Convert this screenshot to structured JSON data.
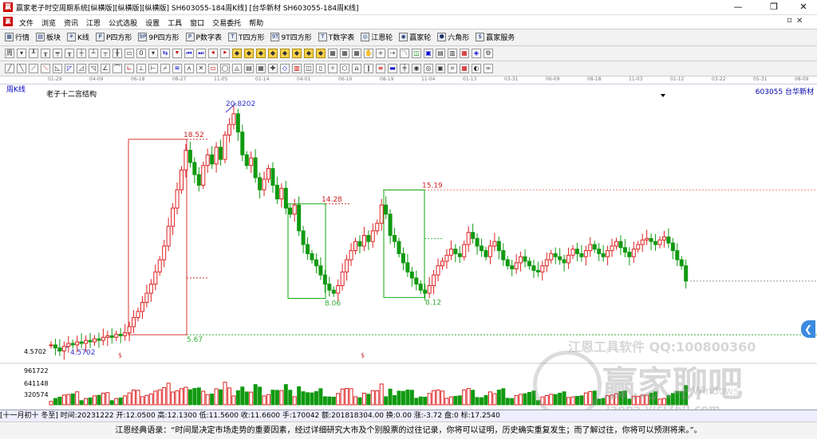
{
  "window": {
    "title": "赢家老子时空周期系统[纵横版][纵横版][纵横版]  SH603055-184周K线]  [台华新材  SH603055-184周K线]",
    "title_short": "赢家老子时空周期系统[纵横版][纵横版][纵横版]  SH603055-184周K线] [台华新材  SH603055-184周K线]"
  },
  "menu": [
    "文件",
    "浏览",
    "资讯",
    "江恩",
    "公式选股",
    "设置",
    "工具",
    "窗口",
    "交易委托",
    "帮助"
  ],
  "toolbar1": [
    "行情",
    "板块",
    "K线",
    "P四方形",
    "9P四方形",
    "P数字表",
    "T四方形",
    "9T四方形",
    "T数字表",
    "江恩轮",
    "赢家轮",
    "六角形",
    "赢家服务"
  ],
  "toolbar2_first": "周",
  "toolbar2_zero": "0",
  "chart": {
    "period_label": "周K线",
    "structure_label": "老子十二宫结构",
    "code_label": "603055  台华新材",
    "date_ticks": [
      "01-29",
      "04-09",
      "06-18",
      "08-27",
      "11-05",
      "01-14",
      "04-01",
      "06-10",
      "08-19",
      "11-04",
      "01-13",
      "03-31",
      "06-09",
      "08-18",
      "11-03",
      "01-12",
      "03-22",
      "05-31",
      "08-09"
    ],
    "price_annotations": [
      "20.8202",
      "18.52",
      "14.28",
      "15.19",
      "8.06",
      "8.12",
      "5.67",
      "4.5702"
    ],
    "left_axis": [
      "4.5702",
      "961722",
      "641148",
      "320574"
    ],
    "dollar_marks": [
      "$",
      "$"
    ]
  },
  "chart_data": {
    "type": "candlestick",
    "price_range": [
      4.0,
      21.5
    ],
    "key_levels": {
      "high": 20.8202,
      "box1_top": 18.52,
      "box2_top": 14.28,
      "box3_top": 15.19,
      "box2_low": 8.06,
      "box3_low": 8.12,
      "box1_low": 5.67,
      "start_low": 4.5702
    },
    "close_series": [
      5.0,
      4.8,
      4.6,
      4.9,
      5.1,
      5.0,
      5.2,
      5.1,
      5.3,
      5.2,
      5.4,
      5.3,
      5.5,
      5.6,
      5.5,
      5.7,
      5.6,
      5.8,
      6.2,
      6.8,
      7.2,
      7.8,
      8.4,
      9.0,
      9.8,
      10.6,
      11.5,
      12.8,
      14.0,
      15.2,
      16.5,
      17.8,
      17.0,
      16.2,
      15.5,
      16.8,
      17.5,
      16.9,
      18.0,
      17.2,
      18.8,
      19.5,
      20.2,
      19.0,
      17.5,
      16.8,
      17.3,
      16.0,
      15.2,
      15.9,
      16.6,
      15.5,
      14.6,
      15.3,
      14.0,
      13.6,
      14.2,
      12.5,
      11.6,
      11.0,
      10.6,
      10.2,
      9.6,
      9.0,
      8.6,
      8.4,
      8.9,
      9.8,
      10.6,
      11.2,
      11.8,
      11.5,
      12.2,
      11.8,
      12.5,
      13.0,
      14.2,
      13.6,
      12.2,
      11.8,
      11.0,
      10.4,
      9.8,
      9.4,
      9.0,
      8.6,
      8.4,
      8.9,
      9.6,
      10.2,
      10.5,
      10.9,
      11.3,
      11.0,
      10.8,
      11.6,
      12.4,
      12.0,
      11.5,
      11.2,
      10.8,
      11.5,
      11.8,
      11.2,
      10.6,
      10.2,
      10.0,
      10.4,
      10.8,
      10.5,
      10.2,
      9.9,
      9.8,
      10.2,
      10.6,
      11.0,
      10.8,
      10.6,
      10.4,
      10.9,
      11.3,
      11.0,
      10.8,
      11.2,
      11.6,
      11.3,
      11.0,
      10.8,
      11.2,
      11.5,
      11.8,
      11.4,
      11.1,
      10.8,
      11.3,
      11.6,
      11.9,
      12.0,
      11.8,
      11.6,
      11.9,
      12.1,
      11.7,
      11.2,
      10.6,
      10.2,
      9.2
    ],
    "volume_range": [
      0,
      1282296
    ]
  },
  "status": {
    "text": "[十一月初十 冬至] 时间:20231222 开:12.0500 高:12.1300 低:11.5600 收:11.6600 手:170042 额:201818304.00 换:0.00 涨:-3.72 盘:0 标:17.2540"
  },
  "footer": {
    "text": "江恩经典语录：“时间是决定市场走势的重要因素，经过详细研究大市及个别股票的过往记录，你将可以证明，历史确实重复发生；而了解过往，你将可以预测将来。”。"
  },
  "watermark": {
    "line1": "江恩工具软件  QQ:100800360",
    "brand": "赢家聊吧",
    "url": "iaopa.yici360.com",
    "os": "Windows"
  },
  "colors": {
    "up": "#dd2222",
    "down": "#109a10",
    "box": "#dd3333",
    "box_green": "#11aa11",
    "annot": "#cc2222"
  }
}
